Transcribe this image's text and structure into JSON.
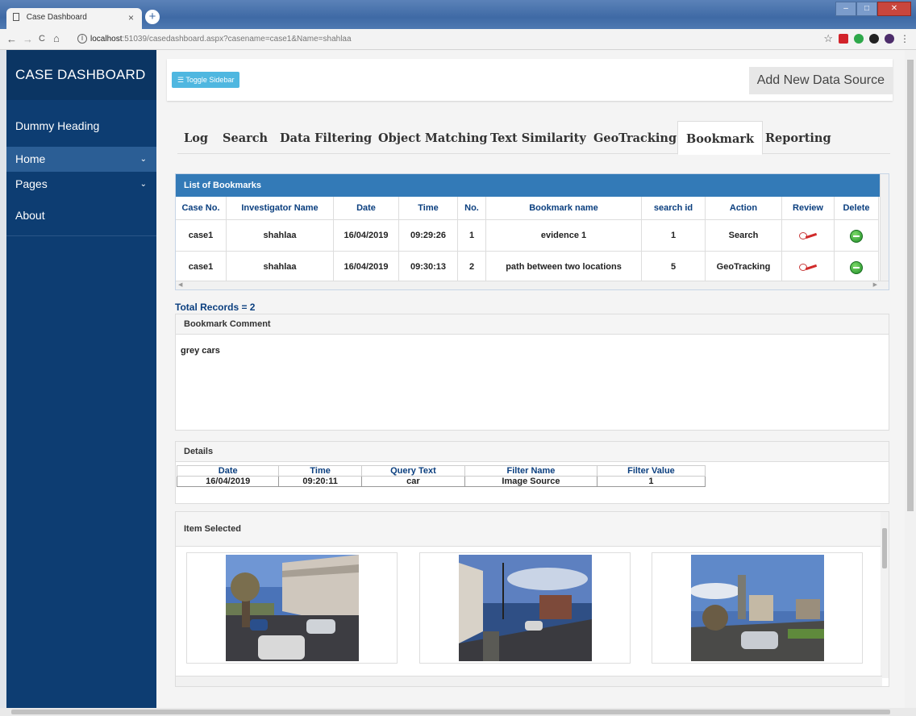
{
  "browser": {
    "tab_title": "Case Dashboard",
    "tab_close": "×",
    "new_tab": "+",
    "nav_back": "←",
    "nav_forward": "→",
    "nav_reload": "C",
    "nav_home": "⌂",
    "url_host": "localhost",
    "url_rest": ":51039/casedashboard.aspx?casename=case1&Name=shahlaa",
    "win_min": "–",
    "win_max": "□",
    "win_close": "✕",
    "bookmark_star": "☆",
    "menu_dots": "⋮"
  },
  "sidebar": {
    "brand": "CASE DASHBOARD",
    "heading": "Dummy Heading",
    "items": [
      {
        "label": "Home",
        "chevron": "⌄"
      },
      {
        "label": "Pages",
        "chevron": "⌄"
      },
      {
        "label": "About"
      }
    ]
  },
  "topbar": {
    "toggle_label": "☰ Toggle Sidebar",
    "add_source_label": "Add New Data Source"
  },
  "tabs": [
    "Log",
    "Search",
    "Data Filtering",
    "Object Matching",
    "Text Similarity",
    "GeoTracking",
    "Bookmark",
    "Reporting"
  ],
  "active_tab": "Bookmark",
  "bookmarks": {
    "title": "List of Bookmarks",
    "columns": [
      "Case No.",
      "Investigator Name",
      "Date",
      "Time",
      "No.",
      "Bookmark name",
      "search id",
      "Action",
      "Review",
      "Delete"
    ],
    "rows": [
      [
        "case1",
        "shahlaa",
        "16/04/2019",
        "09:29:26",
        "1",
        "evidence 1",
        "1",
        "Search"
      ],
      [
        "case1",
        "shahlaa",
        "16/04/2019",
        "09:30:13",
        "2",
        "path between two locations",
        "5",
        "GeoTracking"
      ]
    ],
    "total": "Total Records = 2"
  },
  "comment": {
    "title": "Bookmark Comment",
    "text": "grey cars"
  },
  "details": {
    "title": "Details",
    "columns": [
      "Date",
      "Time",
      "Query Text",
      "Filter Name",
      "Filter Value"
    ],
    "row": [
      "16/04/2019",
      "09:20:11",
      "car",
      "Image Source",
      "1"
    ]
  },
  "items_selected": {
    "title": "Item Selected",
    "images": [
      "street-photo-1",
      "street-photo-2",
      "street-photo-3"
    ]
  },
  "colors": {
    "sidebar_bg": "#0d3d72",
    "panel_header": "#337ab7",
    "toggle_button": "#4fb7e0"
  }
}
